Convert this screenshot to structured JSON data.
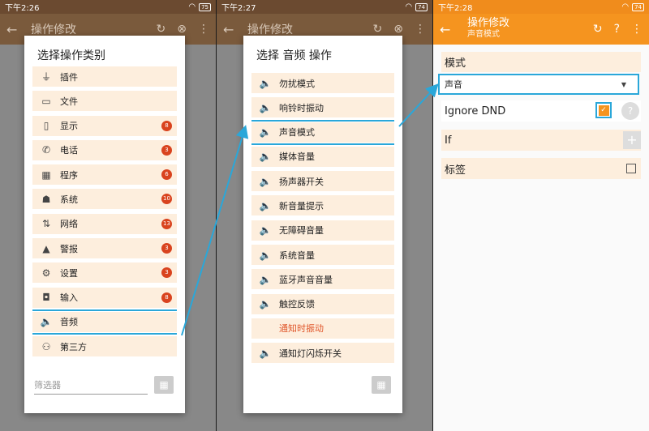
{
  "panel1": {
    "status": {
      "time": "下午2:26",
      "battery": "75"
    },
    "appbar_title": "操作修改",
    "dialog_title": "选择操作类别",
    "items": [
      {
        "icon": "plugin-icon",
        "glyph": "⏚",
        "label": "插件",
        "badge": ""
      },
      {
        "icon": "folder-icon",
        "glyph": "▭",
        "label": "文件",
        "badge": ""
      },
      {
        "icon": "phone-device-icon",
        "glyph": "▯",
        "label": "显示",
        "badge": "8"
      },
      {
        "icon": "call-icon",
        "glyph": "✆",
        "label": "电话",
        "badge": "3"
      },
      {
        "icon": "apps-icon",
        "glyph": "▦",
        "label": "程序",
        "badge": "6"
      },
      {
        "icon": "android-icon",
        "glyph": "☗",
        "label": "系统",
        "badge": "10"
      },
      {
        "icon": "network-icon",
        "glyph": "⇅",
        "label": "网络",
        "badge": "13"
      },
      {
        "icon": "warning-icon",
        "glyph": "▲",
        "label": "警报",
        "badge": "3"
      },
      {
        "icon": "settings-icon",
        "glyph": "⚙",
        "label": "设置",
        "badge": "3"
      },
      {
        "icon": "mouse-icon",
        "glyph": "◘",
        "label": "输入",
        "badge": "8"
      },
      {
        "icon": "speaker-icon",
        "glyph": "🔈",
        "label": "音频",
        "badge": ""
      },
      {
        "icon": "group-add-icon",
        "glyph": "⚇",
        "label": "第三方",
        "badge": ""
      }
    ],
    "filter_placeholder": "筛选器"
  },
  "panel2": {
    "status": {
      "time": "下午2:27",
      "battery": "74"
    },
    "appbar_title": "操作修改",
    "dialog_title": "选择 音频 操作",
    "items": [
      {
        "label": "勿扰模式",
        "orange": false
      },
      {
        "label": "响铃时振动",
        "orange": false
      },
      {
        "label": "声音模式",
        "orange": false
      },
      {
        "label": "媒体音量",
        "orange": false
      },
      {
        "label": "扬声器开关",
        "orange": false
      },
      {
        "label": "新音量提示",
        "orange": false
      },
      {
        "label": "无障碍音量",
        "orange": false
      },
      {
        "label": "系统音量",
        "orange": false
      },
      {
        "label": "蓝牙声音音量",
        "orange": false
      },
      {
        "label": "触控反馈",
        "orange": false
      },
      {
        "label": "通知时振动",
        "orange": true
      },
      {
        "label": "通知灯闪烁开关",
        "orange": false
      }
    ]
  },
  "panel3": {
    "status": {
      "time": "下午2:28",
      "battery": "74"
    },
    "title": "操作修改",
    "subtitle": "声音模式",
    "mode_label": "模式",
    "mode_value": "声音",
    "ignore_dnd_label": "Ignore DND",
    "if_label": "If",
    "tag_label": "标签"
  },
  "colors": {
    "accent": "#f5941f",
    "highlight": "#2aa7d9",
    "row_bg": "#fdeedd",
    "badge": "#d9431e"
  }
}
